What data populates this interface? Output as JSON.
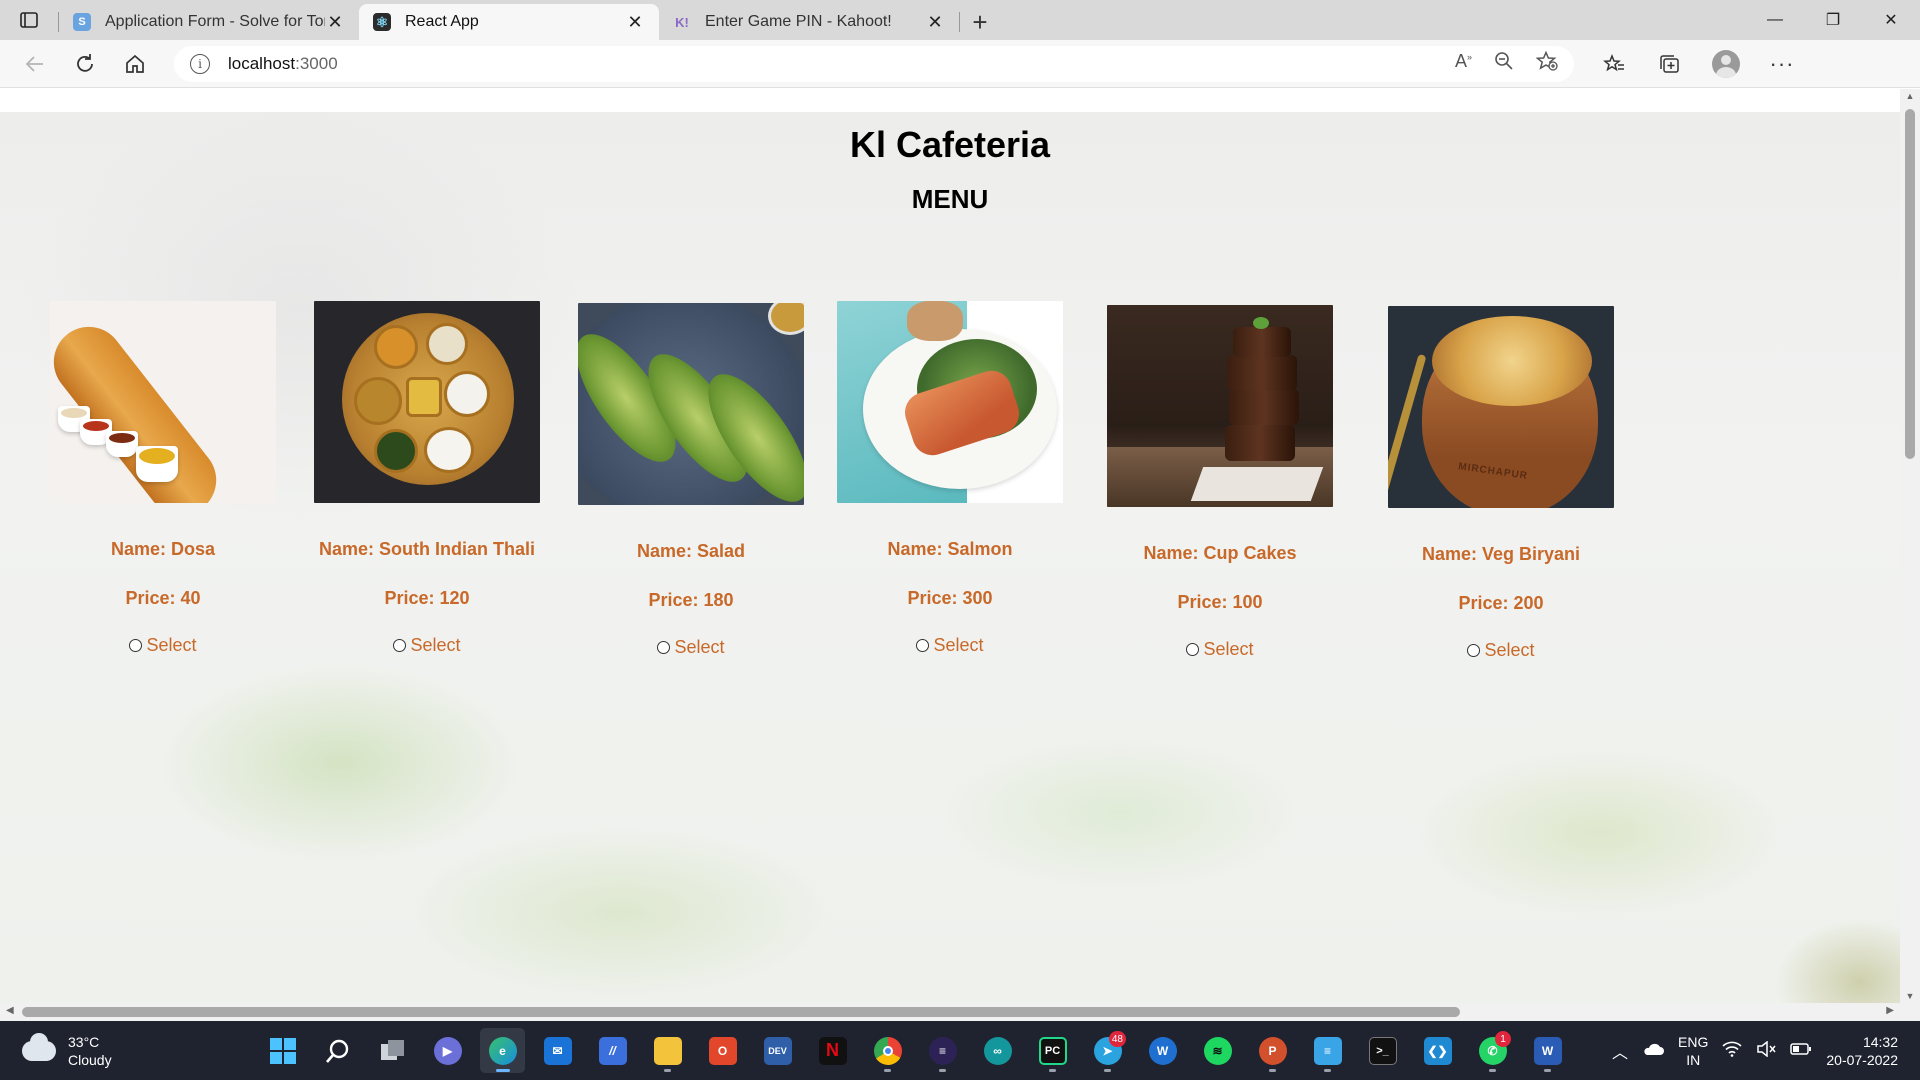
{
  "browser": {
    "tabs": [
      {
        "title": "Application Form - Solve for Tomorrow",
        "favicon": "S",
        "favicon_color": "#6aa4e0",
        "active": false
      },
      {
        "title": "React App",
        "favicon": "⚛",
        "favicon_color": "#2b2b2b",
        "active": true
      },
      {
        "title": "Enter Game PIN - Kahoot!",
        "favicon": "K!",
        "favicon_color": "#8b69c7",
        "active": false
      }
    ],
    "url_host": "localhost",
    "url_port": ":3000"
  },
  "page": {
    "title": "Kl Cafeteria",
    "subtitle": "MENU",
    "select_label": "Select",
    "items": [
      {
        "name_text": "Name: Dosa",
        "price_text": "Price: 40",
        "image": "dosa"
      },
      {
        "name_text": "Name: South Indian Thali",
        "price_text": "Price: 120",
        "image": "thali"
      },
      {
        "name_text": "Name: Salad",
        "price_text": "Price: 180",
        "image": "salad"
      },
      {
        "name_text": "Name: Salmon",
        "price_text": "Price: 300",
        "image": "salmon"
      },
      {
        "name_text": "Name: Cup Cakes",
        "price_text": "Price: 100",
        "image": "cake"
      },
      {
        "name_text": "Name: Veg Biryani",
        "price_text": "Price: 200",
        "image": "biryani"
      }
    ],
    "biryani_pot_label": "MIRCHAPUR",
    "accent_color": "#c8692a"
  },
  "taskbar": {
    "weather_temp": "33°C",
    "weather_desc": "Cloudy",
    "lang_primary": "ENG",
    "lang_secondary": "IN",
    "time": "14:32",
    "date": "20-07-2022",
    "badges": {
      "telegram": "48",
      "whatsapp": "1"
    },
    "apps": [
      "windows-start",
      "search",
      "task-view",
      "teams-chat",
      "edge",
      "mail",
      "vscode-insiders",
      "file-explorer",
      "office",
      "dev-c",
      "netflix",
      "chrome",
      "eclipse",
      "arduino",
      "pycharm",
      "telegram",
      "webex",
      "spotify",
      "powerpoint",
      "notepad",
      "terminal",
      "vscode",
      "whatsapp",
      "word"
    ]
  }
}
